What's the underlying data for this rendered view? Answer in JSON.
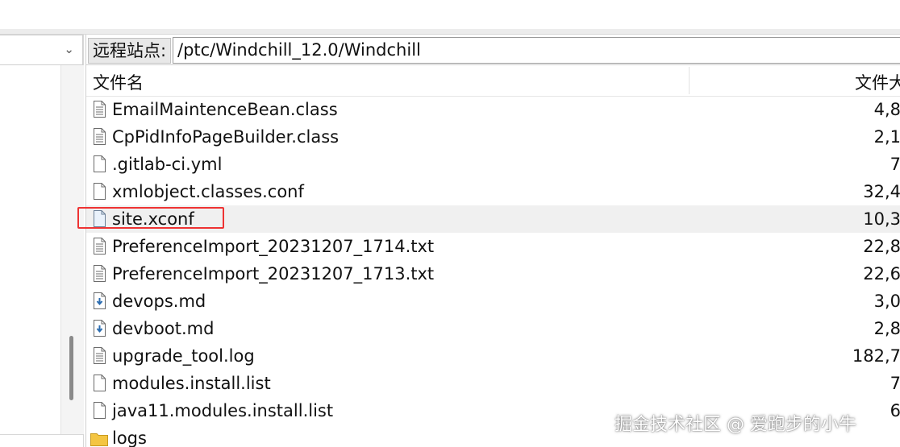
{
  "remote_site": {
    "label": "远程站点:",
    "path": "/ptc/Windchill_12.0/Windchill"
  },
  "columns": {
    "name": "文件名",
    "size": "文件大"
  },
  "files": [
    {
      "name": "EmailMaintenceBean.class",
      "size": "4,8",
      "icon": "text-file-icon"
    },
    {
      "name": "CpPidInfoPageBuilder.class",
      "size": "2,1",
      "icon": "text-file-icon"
    },
    {
      "name": ".gitlab-ci.yml",
      "size": "7",
      "icon": "blank-file-icon"
    },
    {
      "name": "xmlobject.classes.conf",
      "size": "32,4",
      "icon": "blank-file-icon"
    },
    {
      "name": "site.xconf",
      "size": "10,3",
      "icon": "xml-file-icon",
      "selected": true
    },
    {
      "name": "PreferenceImport_20231207_1714.txt",
      "size": "22,8",
      "icon": "text-file-icon"
    },
    {
      "name": "PreferenceImport_20231207_1713.txt",
      "size": "22,6",
      "icon": "text-file-icon"
    },
    {
      "name": "devops.md",
      "size": "3,0",
      "icon": "markdown-file-icon"
    },
    {
      "name": "devboot.md",
      "size": "2,8",
      "icon": "markdown-file-icon"
    },
    {
      "name": "upgrade_tool.log",
      "size": "182,7",
      "icon": "text-file-icon"
    },
    {
      "name": "modules.install.list",
      "size": "7",
      "icon": "blank-file-icon"
    },
    {
      "name": "java11.modules.install.list",
      "size": "6",
      "icon": "blank-file-icon"
    },
    {
      "name": "logs",
      "size": "",
      "icon": "folder-icon"
    }
  ],
  "watermark": "掘金技术社区 @ 爱跑步的小牛",
  "colors": {
    "highlight_box": "#e33333",
    "selected_row": "#f0f0f0",
    "folder": "#f4c542",
    "markdown_arrow": "#2b6cb0"
  }
}
